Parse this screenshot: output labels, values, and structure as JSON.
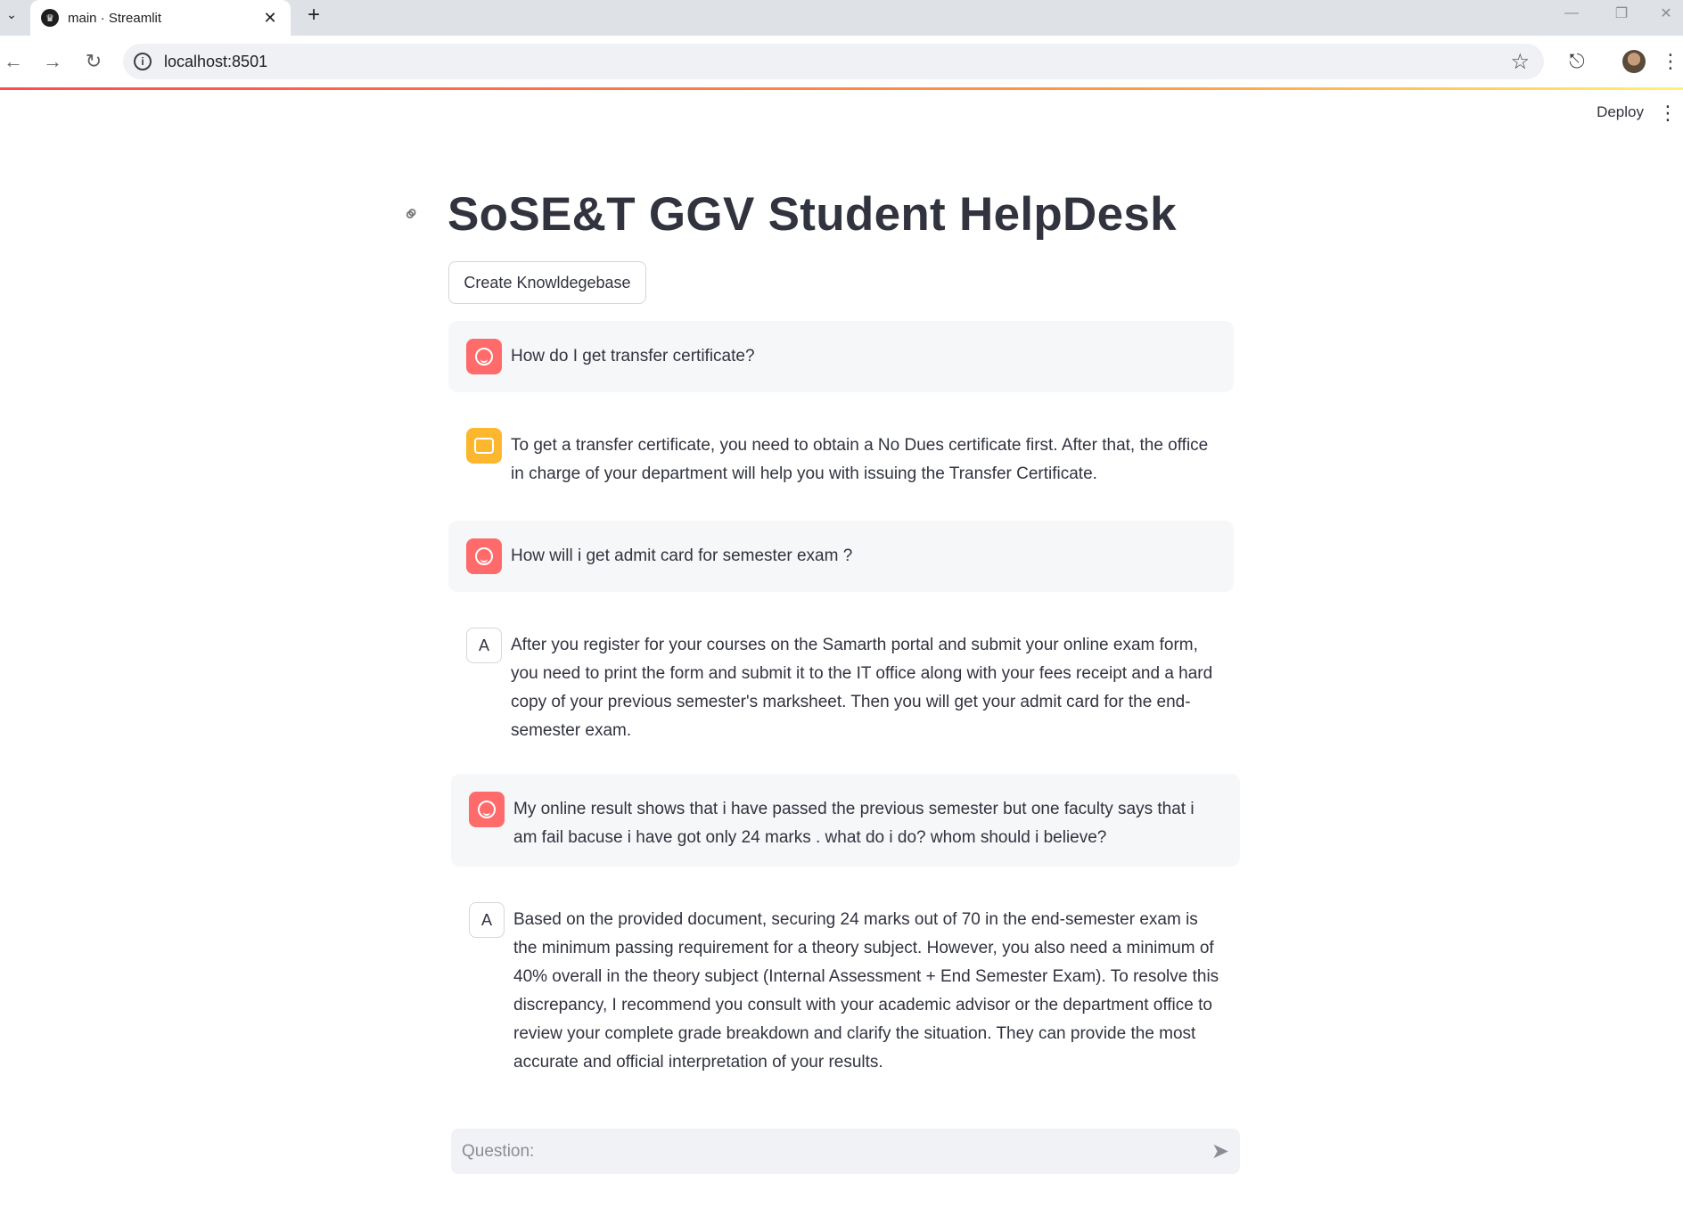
{
  "browser": {
    "tab_title": "main · Streamlit",
    "url": "localhost:8501"
  },
  "header": {
    "deploy_label": "Deploy"
  },
  "page": {
    "title": "SoSE&T GGV Student HelpDesk",
    "kb_button_label": "Create Knowldegebase"
  },
  "messages": [
    {
      "role": "user",
      "avatar": "user-face-icon",
      "text": "How do I get transfer certificate?"
    },
    {
      "role": "assistant",
      "avatar": "bot-icon",
      "text": "To get a transfer certificate, you need to obtain a No Dues certificate first. After that, the office in charge of your department will help you with issuing the Transfer Certificate."
    },
    {
      "role": "user",
      "avatar": "user-face-icon",
      "text": "How will i get admit card for semester exam ?"
    },
    {
      "role": "assistant",
      "avatar_letter": "A",
      "text": "After you register for your courses on the Samarth portal and submit your online exam form, you need to print the form and submit it to the IT office along with your fees receipt and a hard copy of your previous semester's marksheet. Then you will get your admit card for the end-semester exam."
    },
    {
      "role": "user",
      "avatar": "user-face-icon",
      "text": "My online result shows that i have passed the previous semester but one faculty says that i am fail bacuse i have got only 24 marks . what do i do? whom should i believe?"
    },
    {
      "role": "assistant",
      "avatar_letter": "A",
      "text": "Based on the provided document, securing 24 marks out of 70 in the end-semester exam is the minimum passing requirement for a theory subject. However, you also need a minimum of 40% overall in the theory subject (Internal Assessment + End Semester Exam). To resolve this discrepancy, I recommend you consult with your academic advisor or the department office to review your complete grade breakdown and clarify the situation. They can provide the most accurate and official interpretation of your results."
    }
  ],
  "chat_input": {
    "placeholder": "Question:",
    "value": ""
  },
  "colors": {
    "user_avatar": "#ff6b6b",
    "bot_avatar": "#fdb72f",
    "user_bubble": "#f6f7f9"
  }
}
